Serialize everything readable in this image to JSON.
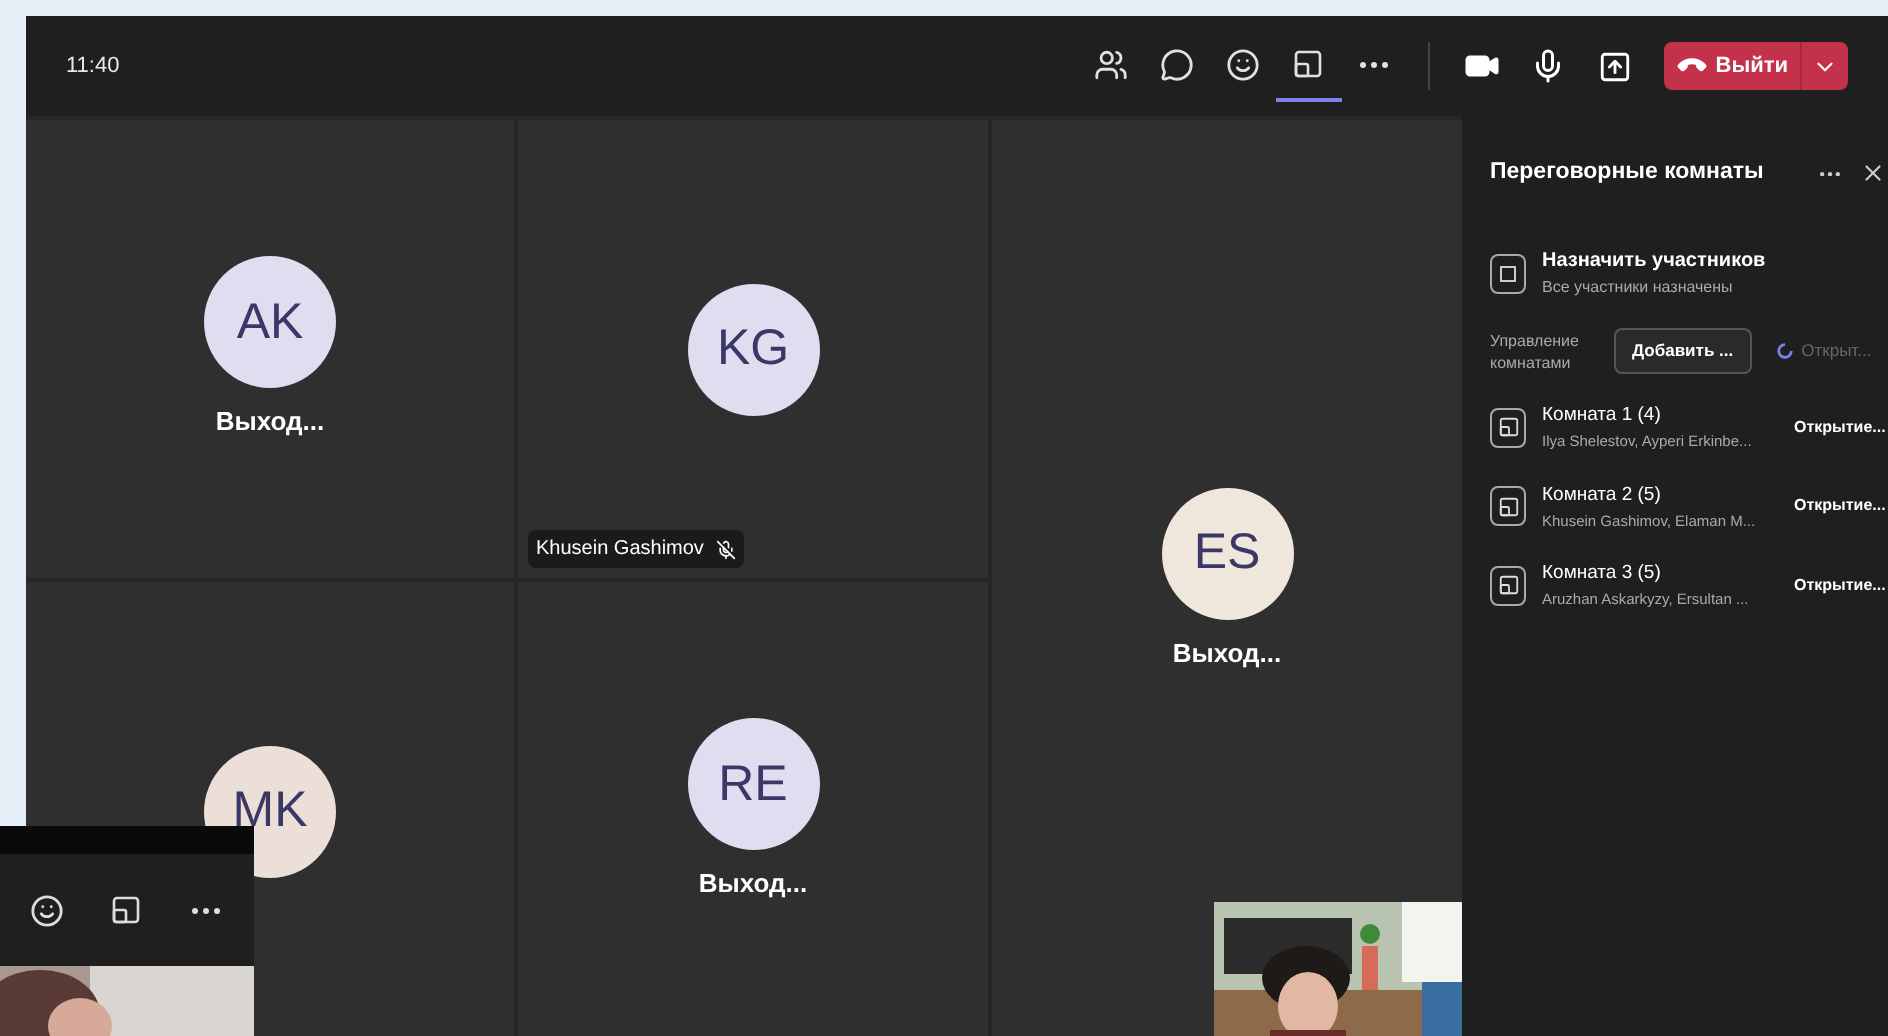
{
  "window": {
    "time": "11:40"
  },
  "toolbar": {
    "buttons": [
      {
        "kind": "participants",
        "selected": false
      },
      {
        "kind": "chat",
        "selected": false
      },
      {
        "kind": "reactions",
        "selected": false
      },
      {
        "kind": "rooms",
        "selected": true
      },
      {
        "kind": "more",
        "selected": false
      }
    ],
    "leave_button": {
      "label": "Выйти"
    }
  },
  "tiles": [
    {
      "kind": "normal",
      "initials": "AK",
      "color": "#e1dcef",
      "name": "Выход..."
    },
    {
      "kind": "normal",
      "initials": "KG",
      "color": "#e1dcef",
      "label": "Khusein Gashimov",
      "muted": true
    },
    {
      "kind": "tall",
      "initials": "ES",
      "color": "#efe6dc",
      "name": "Выход..."
    },
    {
      "kind": "normal",
      "initials": "MK",
      "color": "#ecdfd8"
    },
    {
      "kind": "normal",
      "initials": "RE",
      "color": "#e1dcef",
      "name": "Выход..."
    }
  ],
  "panel": {
    "title": "Переговорные комнаты",
    "assign": {
      "title": "Назначить участников",
      "subtitle": "Все участники назначены"
    },
    "manage_label": "Управление комнатами",
    "add_button": "Добавить ...",
    "open_status": {
      "label": "Открыт...",
      "disabled": true
    },
    "rooms": [
      {
        "name": "Комната 1 (4)",
        "members": "Ilya Shelestov, Ayperi Erkinbe...",
        "status": "Открытие..."
      },
      {
        "name": "Комната 2 (5)",
        "members": "Khusein Gashimov, Elaman M...",
        "status": "Открытие..."
      },
      {
        "name": "Комната 3 (5)",
        "members": "Aruzhan Askarkyzy, Ersultan ...",
        "status": "Открытие..."
      }
    ]
  },
  "mini_window": {
    "buttons": [
      {
        "kind": "reactions"
      },
      {
        "kind": "rooms"
      },
      {
        "kind": "more"
      }
    ]
  }
}
